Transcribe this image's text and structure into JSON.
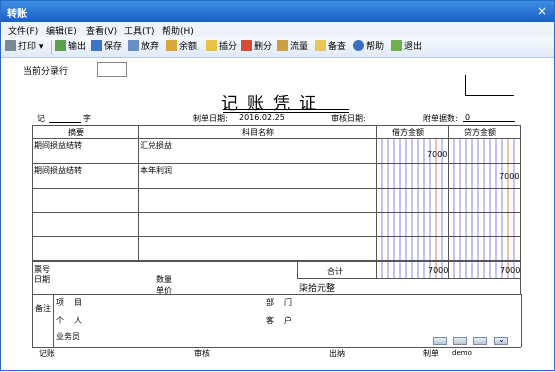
{
  "window": {
    "title": "转账"
  },
  "menu": [
    "文件(F)",
    "编辑(E)",
    "查看(V)",
    "工具(T)",
    "帮助(H)"
  ],
  "toolbar": {
    "print": "打印",
    "export": "输出",
    "save": "保存",
    "discard": "放弃",
    "balance": "余额",
    "insert": "插分",
    "delete": "删分",
    "flow": "流量",
    "note": "备查",
    "help": "帮助",
    "exit": "退出"
  },
  "row_label": "当前分录行",
  "voucher": {
    "title": "记账凭证",
    "type_label": "记",
    "type_suffix": "字",
    "date_label": "制单日期:",
    "date_value": "2016.02.25",
    "audit_date_label": "审核日期:",
    "attach_label": "附单据数:",
    "attach_value": "0",
    "headers": {
      "summary": "摘要",
      "account": "科目名称",
      "debit": "借方金额",
      "credit": "贷方金额"
    },
    "rows": [
      {
        "summary": "期间损益结转",
        "account": "汇兑损益",
        "debit": "7000",
        "credit": ""
      },
      {
        "summary": "期间损益结转",
        "account": "本年利润",
        "debit": "",
        "credit": "7000"
      }
    ],
    "ticket_label": "票号",
    "date_row_label": "日期",
    "qty_label": "数量",
    "price_label": "单价",
    "total_label": "合计",
    "total_debit": "7000",
    "total_credit": "7000",
    "total_words": "柒拾元整",
    "remark_label": "备注",
    "project_label": "项目",
    "dept_label": "部门",
    "person_label": "个人",
    "customer_label": "客户",
    "salesman_label": "业务员",
    "footer": {
      "bookkeeper": "记账",
      "auditor": "审核",
      "cashier": "出纳",
      "maker": "制单",
      "maker_name": "demo"
    }
  },
  "colors": {
    "titlebar": "#1a5fc4",
    "blue_line": "#3b3bd6",
    "red_line": "#d42020"
  }
}
